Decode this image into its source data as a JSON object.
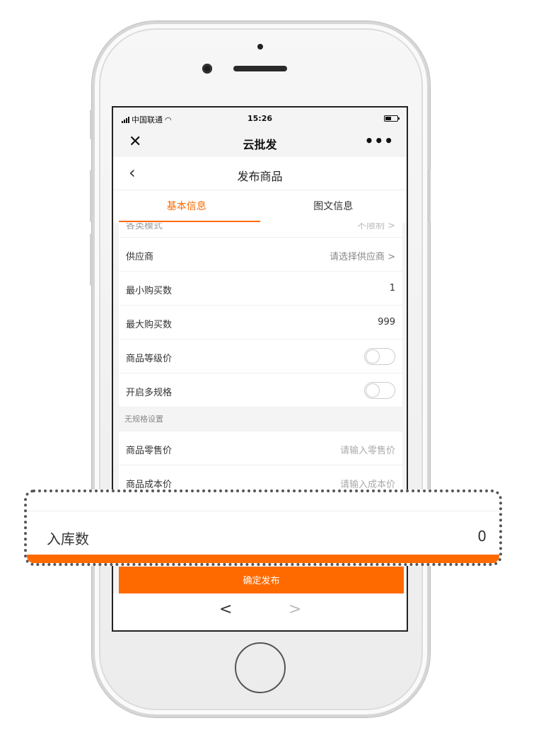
{
  "status_bar": {
    "carrier": "中国联通",
    "time": "15:26"
  },
  "wechat_header": {
    "close_icon": "close-icon",
    "title": "云批发",
    "more_label": "•••"
  },
  "page_header": {
    "back_icon": "chevron-left-icon",
    "title": "发布商品"
  },
  "tabs": [
    {
      "label": "基本信息",
      "active": true
    },
    {
      "label": "图文信息",
      "active": false
    }
  ],
  "form": {
    "partial_row": {
      "label": "各类模式",
      "value": "不限制 >"
    },
    "supplier": {
      "label": "供应商",
      "value": "请选择供应商 >"
    },
    "min_purchase": {
      "label": "最小购买数",
      "value": "1"
    },
    "max_purchase": {
      "label": "最大购买数",
      "value": "999"
    },
    "level_price": {
      "label": "商品等级价",
      "toggle": false
    },
    "multi_spec": {
      "label": "开启多规格",
      "toggle": false
    },
    "section_no_spec": "无规格设置",
    "retail_price": {
      "label": "商品零售价",
      "placeholder": "请输入零售价"
    },
    "cost_price": {
      "label": "商品成本价",
      "placeholder": "请输入成本价"
    }
  },
  "confirm_button": "确定发布",
  "bottom_nav": {
    "back": "<",
    "forward": ">"
  },
  "callout": {
    "label": "入库数",
    "value": "0"
  },
  "colors": {
    "accent": "#ff6a00",
    "placeholder": "#aaaaaa"
  }
}
